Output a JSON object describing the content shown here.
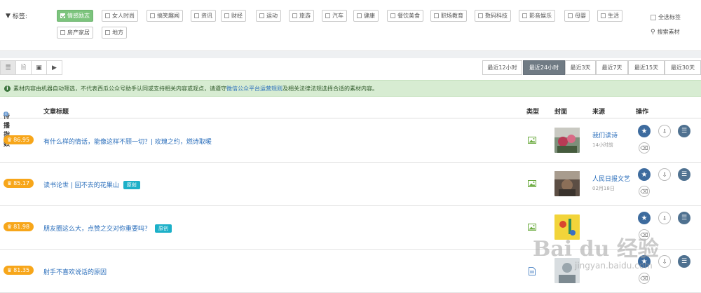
{
  "tags_section": {
    "label": "标签:",
    "tags": [
      {
        "label": "情感励志",
        "active": true
      },
      {
        "label": "女人时尚",
        "active": false
      },
      {
        "label": "搞笑趣闻",
        "active": false
      },
      {
        "label": "资讯",
        "active": false
      },
      {
        "label": "财经",
        "active": false
      },
      {
        "label": "运动",
        "active": false
      },
      {
        "label": "旅游",
        "active": false
      },
      {
        "label": "汽车",
        "active": false
      },
      {
        "label": "健康",
        "active": false
      },
      {
        "label": "餐饮美食",
        "active": false
      },
      {
        "label": "职场教育",
        "active": false
      },
      {
        "label": "数码科技",
        "active": false
      },
      {
        "label": "影音娱乐",
        "active": false
      },
      {
        "label": "母婴",
        "active": false
      },
      {
        "label": "生活",
        "active": false
      },
      {
        "label": "房产家居",
        "active": false
      },
      {
        "label": "地方",
        "active": false
      }
    ],
    "select_all": "全选标签",
    "search": "搜索素材"
  },
  "toolbar": {
    "view_icons": [
      "list-icon",
      "document-icon",
      "image-icon",
      "video-icon"
    ],
    "time_filters": [
      {
        "label": "最近12小时",
        "active": false
      },
      {
        "label": "最近24小时",
        "active": true
      },
      {
        "label": "最近3天",
        "active": false
      },
      {
        "label": "最近7天",
        "active": false
      },
      {
        "label": "最近15天",
        "active": false
      },
      {
        "label": "最近30天",
        "active": false
      }
    ]
  },
  "notice": {
    "text_before": "素材内容由机器自动筛选，不代表西瓜公众号助手认同或支持相关内容或观点，请遵守",
    "link": "微信公众平台运营规则",
    "text_after": "及相关法律法规选择合适的素材内容。"
  },
  "table": {
    "headers": {
      "score": "传播指数",
      "title": "文章标题",
      "type": "类型",
      "cover": "封面",
      "source": "来源",
      "actions": "操作"
    },
    "rows": [
      {
        "score": "86.95",
        "title": "有什么样的情话，能像这样不顾一切？| 玫瑰之约，燃诗取暖",
        "original": "",
        "type": "image",
        "source": "我们读诗",
        "time": "14小时前"
      },
      {
        "score": "85.17",
        "title": "读书论世 | 回不去的花果山",
        "original": "原创",
        "type": "image",
        "source": "人民日报文艺",
        "time": "02月18日"
      },
      {
        "score": "81.98",
        "title": "朋友圈这么大，点赞之交对你重要吗？",
        "original": "原创",
        "type": "image",
        "source": "",
        "time": ""
      },
      {
        "score": "81.35",
        "title": "射手不喜欢说话的原因",
        "original": "",
        "type": "document",
        "source": "",
        "time": ""
      }
    ]
  },
  "watermark": {
    "text": "Bai du 经验",
    "url": "jingyan.baidu.com"
  },
  "colors": {
    "accent_green": "#7cc47d",
    "score_orange": "#f7a61a",
    "link_blue": "#2a6ebb",
    "original_badge": "#1cb0c8",
    "active_filter": "#707b84"
  }
}
